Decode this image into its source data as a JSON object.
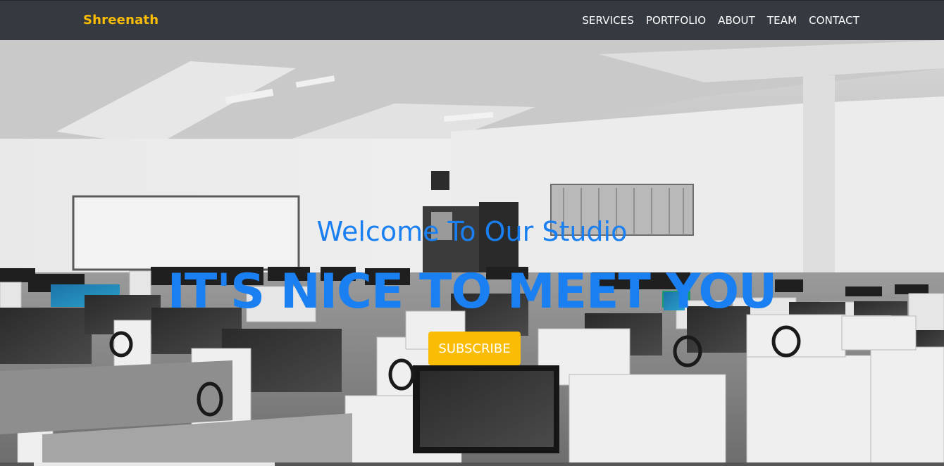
{
  "navbar": {
    "brand": "Shreenath",
    "links": [
      "SERVICES",
      "PORTFOLIO",
      "ABOUT",
      "TEAM",
      "CONTACT"
    ]
  },
  "hero": {
    "welcome": "Welcome To Our Studio",
    "headline": "IT'S NICE TO MEET YOU",
    "subscribe_label": "SUBSCRIBE"
  },
  "colors": {
    "navbar_bg": "#343a40",
    "brand": "#fbbc05",
    "hero_text": "#1a7ff0",
    "button_bg": "#fbbc05"
  }
}
